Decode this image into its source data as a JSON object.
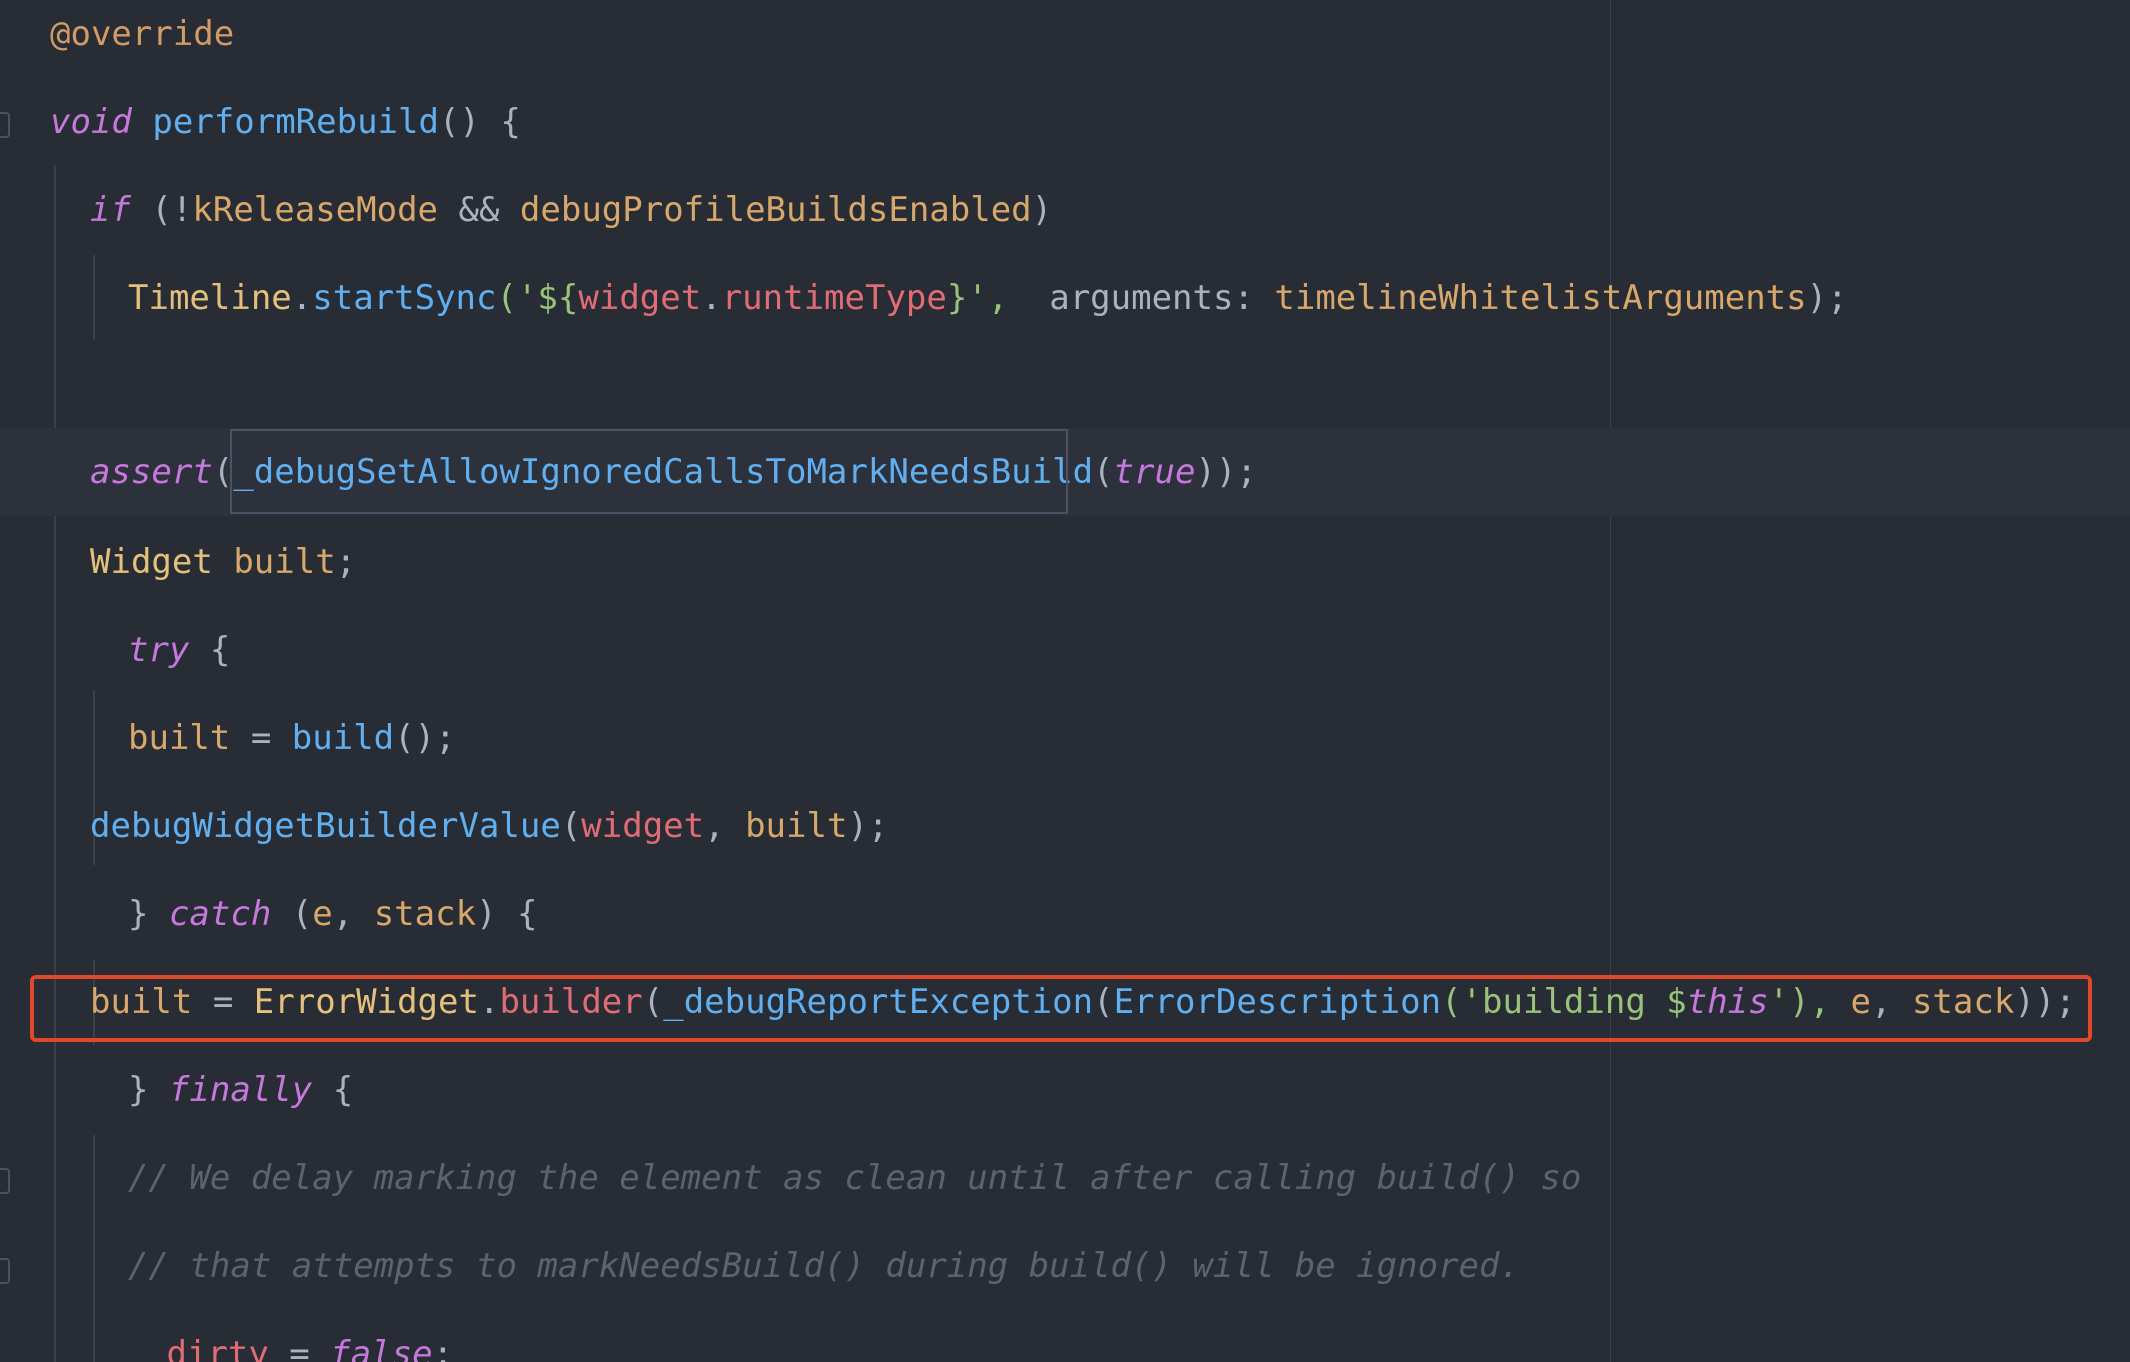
{
  "editor": {
    "language": "dart",
    "theme_colors": {
      "background": "#282c34",
      "keyword": "#c678dd",
      "function": "#61afef",
      "type": "#e5c07b",
      "field": "#e06c75",
      "string": "#98c379",
      "comment": "#5c6370",
      "highlight_border": "#e0482a"
    },
    "lines": [
      {
        "t1": "@override"
      },
      {
        "t1": "void",
        "t2": " ",
        "t3": "performRebuild",
        "t4": "() {"
      },
      {
        "t1": "if",
        "t2": " (!",
        "t3": "kReleaseMode",
        "t4": " && ",
        "t5": "debugProfileBuildsEnabled",
        "t6": ")"
      },
      {
        "t1": "Timeline",
        "t2": ".",
        "t3": "startSync",
        "t4": "('${",
        "t5": "widget",
        "t6": ".",
        "t7": "runtimeType",
        "t8": "}',  ",
        "t9": "arguments: ",
        "t10": "timelineWhitelistArguments",
        "t11": ");"
      },
      {
        "t1": ""
      },
      {
        "t1": "assert",
        "t2": "(",
        "t3": "_debugSetAllowIgnoredCallsToMarkNeedsBuild",
        "t4": "(",
        "t5": "true",
        "t6": "));"
      },
      {
        "t1": "Widget",
        "t2": " ",
        "t3": "built",
        "t4": ";"
      },
      {
        "t1": "try",
        "t2": " {"
      },
      {
        "t1": "built",
        "t2": " = ",
        "t3": "build",
        "t4": "();"
      },
      {
        "t1": "debugWidgetBuilderValue",
        "t2": "(",
        "t3": "widget",
        "t4": ", ",
        "t5": "built",
        "t6": ");"
      },
      {
        "t1": "} ",
        "t2": "catch",
        "t3": " (",
        "t4": "e",
        "t5": ", ",
        "t6": "stack",
        "t7": ") {"
      },
      {
        "t1": "built",
        "t2": " = ",
        "t3": "ErrorWidget",
        "t4": ".",
        "t5": "builder",
        "t6": "(",
        "t7": "_debugReportException",
        "t8": "(",
        "t9": "ErrorDescription",
        "t10": "('building $",
        "t11": "this",
        "t12": "'), ",
        "t13": "e",
        "t14": ", ",
        "t15": "stack",
        "t16": "));"
      },
      {
        "t1": "} ",
        "t2": "finally",
        "t3": " {"
      },
      {
        "t1": "// We delay marking the element as clean until after calling build() so"
      },
      {
        "t1": "// that attempts to markNeedsBuild() during build() will be ignored."
      },
      {
        "t1": "_dirty",
        "t2": " = ",
        "t3": "false",
        "t4": ";"
      }
    ]
  }
}
